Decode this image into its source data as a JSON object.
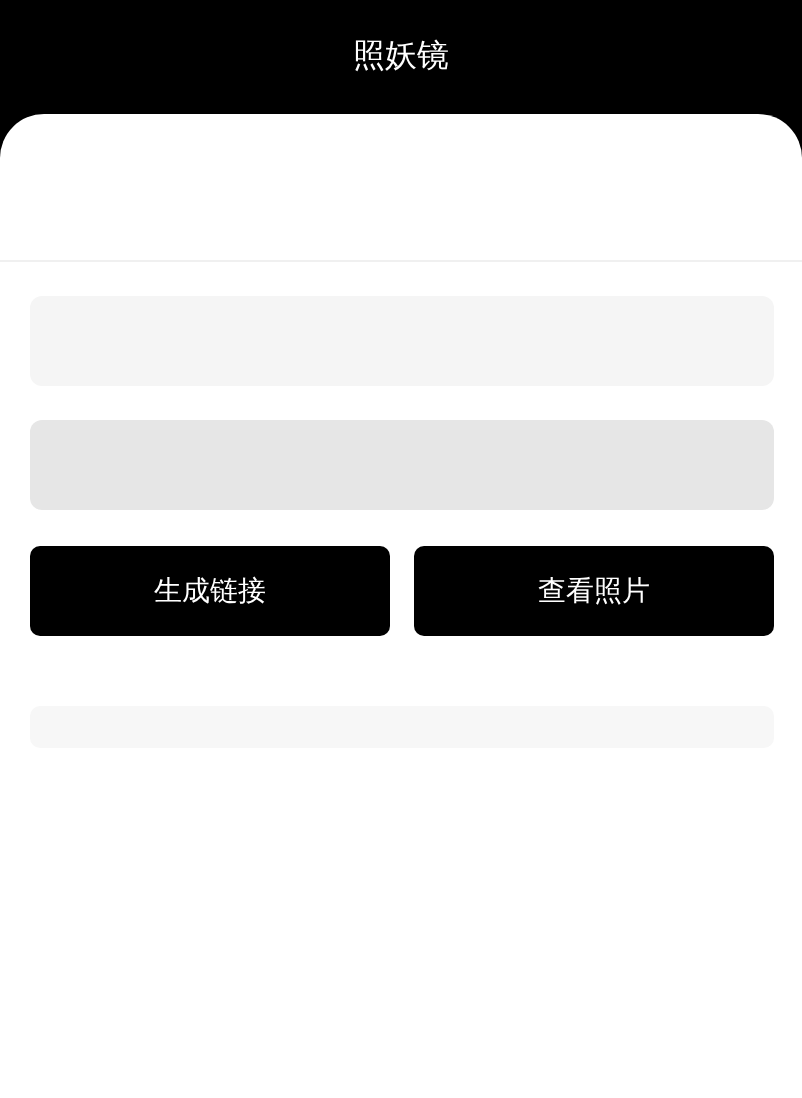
{
  "header": {
    "title": "照妖镜"
  },
  "buttons": [
    {
      "label": "生成链接"
    },
    {
      "label": "查看照片"
    }
  ]
}
